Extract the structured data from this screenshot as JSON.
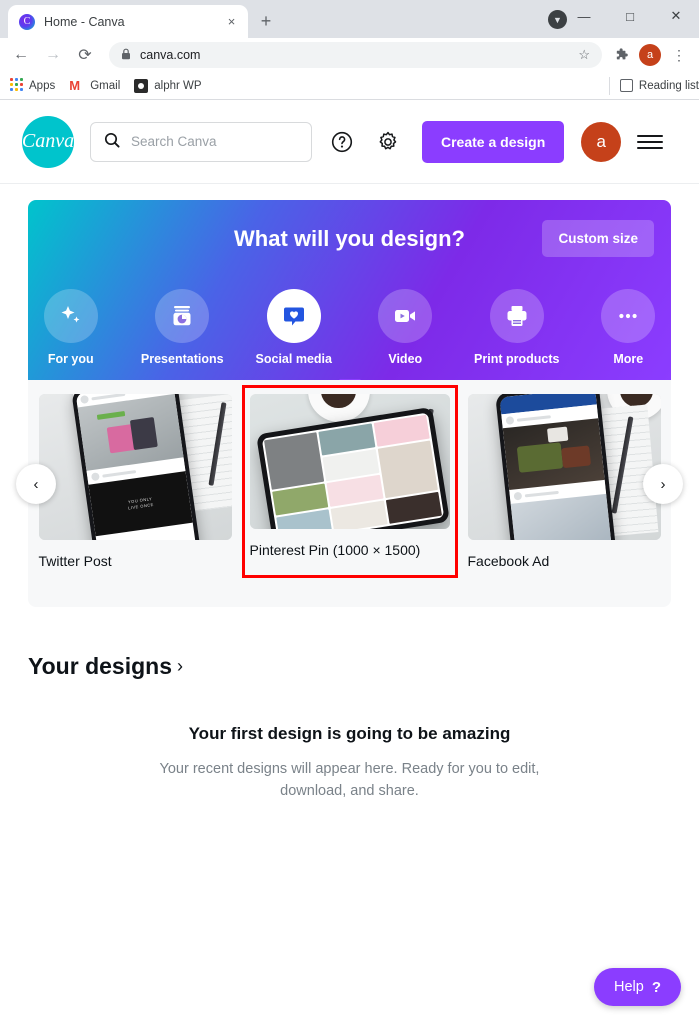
{
  "browser": {
    "tab": {
      "title": "Home - Canva",
      "favicon": "canva-favicon",
      "close": "×"
    },
    "new_tab": "+",
    "window": {
      "download": "▼",
      "minimize": "—",
      "maximize": "□",
      "close": "✕"
    },
    "nav": {
      "back": "←",
      "forward": "→",
      "reload": "⟳"
    },
    "omnibox": {
      "lock": "🔒",
      "url": "canva.com",
      "star": "☆"
    },
    "extensions": "❖",
    "profile_initial": "a",
    "menu": "⋮",
    "bookmarks": [
      {
        "label": "Apps",
        "icon": "apps-grid-icon"
      },
      {
        "label": "Gmail",
        "icon": "gmail-icon"
      },
      {
        "label": "alphr WP",
        "icon": "wordpress-icon"
      }
    ],
    "reading_list": {
      "label": "Reading list",
      "icon": "reading-list-icon"
    }
  },
  "header": {
    "logo_text": "Canva",
    "search": {
      "placeholder": "Search Canva",
      "icon": "search-icon"
    },
    "help_icon": "question-circle-icon",
    "settings_icon": "gear-icon",
    "create_button": "Create a design",
    "avatar_initial": "a",
    "menu_icon": "hamburger-icon"
  },
  "banner": {
    "title": "What will you design?",
    "custom_size": "Custom size",
    "accent_purple": "#8b3dff",
    "accent_teal": "#00c4cc",
    "categories": [
      {
        "label": "For you",
        "icon": "sparkle-icon",
        "active": false
      },
      {
        "label": "Presentations",
        "icon": "presentation-icon",
        "active": false
      },
      {
        "label": "Social media",
        "icon": "heart-bubble-icon",
        "active": true
      },
      {
        "label": "Video",
        "icon": "video-camera-icon",
        "active": false
      },
      {
        "label": "Print products",
        "icon": "printer-icon",
        "active": false
      },
      {
        "label": "More",
        "icon": "ellipsis-icon",
        "active": false
      }
    ]
  },
  "carousel": {
    "prev": "‹",
    "next": "›",
    "highlight_color": "#ff0000",
    "cards": [
      {
        "label": "Twitter Post",
        "selected": false
      },
      {
        "label": "Pinterest Pin (1000 × 1500)",
        "selected": true
      },
      {
        "label": "Facebook Ad",
        "selected": false
      }
    ]
  },
  "designs": {
    "heading": "Your designs",
    "chevron": "›",
    "empty_title": "Your first design is going to be amazing",
    "empty_subtitle": "Your recent designs will appear here. Ready for you to edit, download, and share."
  },
  "help": {
    "label": "Help",
    "mark": "?"
  }
}
